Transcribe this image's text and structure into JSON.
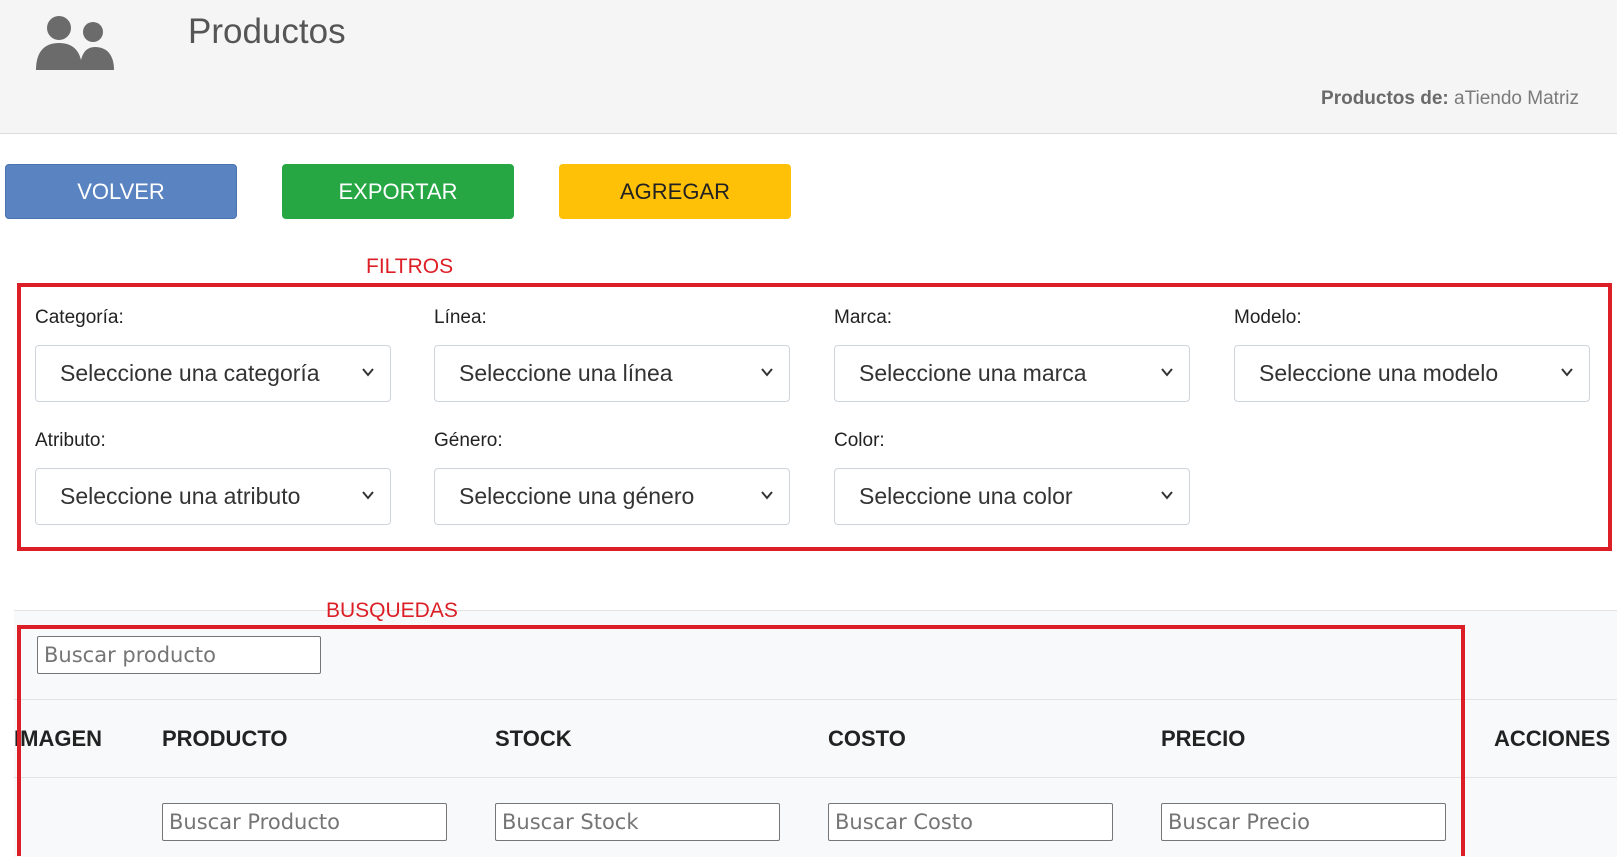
{
  "header": {
    "title": "Productos",
    "owner_label": "Productos de:",
    "owner_value": "aTiendo Matriz",
    "icon": "users-icon"
  },
  "actions": {
    "volver": "VOLVER",
    "exportar": "EXPORTAR",
    "agregar": "AGREGAR"
  },
  "annotations": {
    "filtros": "FILTROS",
    "busquedas": "BUSQUEDAS"
  },
  "filters": [
    {
      "label": "Categoría:",
      "value": "Seleccione una categoría"
    },
    {
      "label": "Línea:",
      "value": "Seleccione una línea"
    },
    {
      "label": "Marca:",
      "value": "Seleccione una marca"
    },
    {
      "label": "Modelo:",
      "value": "Seleccione una modelo"
    },
    {
      "label": "Atributo:",
      "value": "Seleccione una atributo"
    },
    {
      "label": "Género:",
      "value": "Seleccione una género"
    },
    {
      "label": "Color:",
      "value": "Seleccione una color"
    }
  ],
  "search": {
    "placeholder": "Buscar producto"
  },
  "table": {
    "columns": [
      "IMAGEN",
      "PRODUCTO",
      "STOCK",
      "COSTO",
      "PRECIO",
      "ACCIONES"
    ],
    "column_search": [
      "Buscar Producto",
      "Buscar Stock",
      "Buscar Costo",
      "Buscar Precio"
    ]
  },
  "colors": {
    "volver": "#5a83c1",
    "exportar": "#26a744",
    "agregar": "#ffc107",
    "annotation": "#dc1f26"
  }
}
